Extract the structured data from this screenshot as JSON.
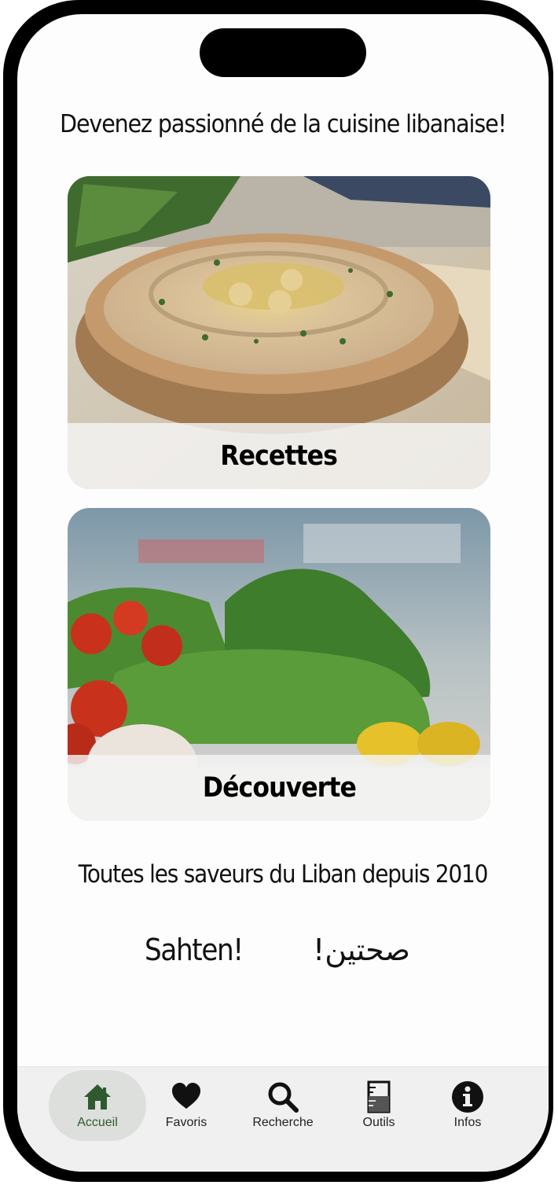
{
  "headline": "Devenez passionné de la cuisine libanaise!",
  "cards": [
    {
      "label": "Recettes",
      "image": "hummus-bowl-photo"
    },
    {
      "label": "Découverte",
      "image": "vegetables-herbs-photo"
    }
  ],
  "tagline": "Toutes les saveurs du Liban depuis 2010",
  "greeting": {
    "french": "Sahten!",
    "arabic": "صحتين!"
  },
  "tabbar": {
    "active": "Accueil",
    "accent_color": "#2f5a2f",
    "tabs": [
      {
        "label": "Accueil",
        "icon": "home-icon"
      },
      {
        "label": "Favoris",
        "icon": "heart-icon"
      },
      {
        "label": "Recherche",
        "icon": "search-icon"
      },
      {
        "label": "Outils",
        "icon": "measuring-cup-icon"
      },
      {
        "label": "Infos",
        "icon": "info-icon"
      }
    ]
  }
}
